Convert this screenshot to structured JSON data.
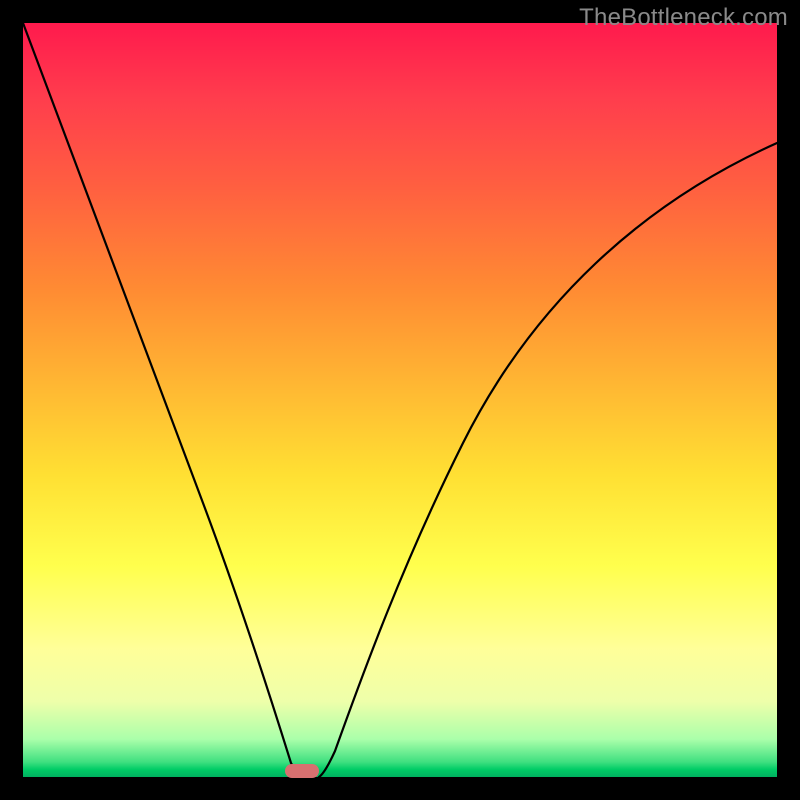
{
  "watermark": "TheBottleneck.com",
  "colors": {
    "background": "#000000",
    "curve": "#000000",
    "nub": "#d87070"
  },
  "chart_data": {
    "type": "line",
    "title": "",
    "xlabel": "",
    "ylabel": "",
    "xlim": [
      0,
      100
    ],
    "ylim": [
      0,
      100
    ],
    "grid": false,
    "legend": false,
    "series": [
      {
        "name": "left-branch",
        "x": [
          0,
          4,
          8,
          12,
          16,
          20,
          24,
          28,
          31,
          34,
          36,
          37.2
        ],
        "y": [
          100,
          92,
          83,
          74,
          64,
          53,
          42,
          30,
          19,
          9,
          2,
          0
        ]
      },
      {
        "name": "right-branch",
        "x": [
          39.3,
          41,
          44,
          48,
          53,
          59,
          66,
          74,
          83,
          92,
          100
        ],
        "y": [
          0,
          3,
          10,
          21,
          33,
          45,
          56,
          65,
          73,
          79,
          84
        ]
      }
    ],
    "marker": {
      "name": "optimum-nub",
      "x_center": 38.2,
      "y": 0,
      "width_x": 4.5
    },
    "gradient_stops": [
      {
        "pos": 0.0,
        "color": "#ff1a4d"
      },
      {
        "pos": 0.35,
        "color": "#ff8a33"
      },
      {
        "pos": 0.72,
        "color": "#ffff4d"
      },
      {
        "pos": 1.0,
        "color": "#00b060"
      }
    ]
  }
}
